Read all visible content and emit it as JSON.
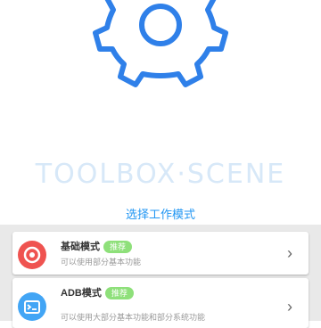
{
  "brand": "TOOLBOX·SCENE",
  "mode_title": "选择工作模式",
  "modes": [
    {
      "title": "基础模式",
      "badge": "推荐",
      "description": "可以使用部分基本功能",
      "icon": "circle-dot-icon",
      "color": "#ef5350"
    },
    {
      "title": "ADB模式",
      "badge": "推荐",
      "description": "可以使用大部分基本功能和部分系统功能",
      "icon": "terminal-icon",
      "color": "#42a5f5"
    }
  ],
  "colors": {
    "accent": "#2196f3",
    "badge": "#8ee07a"
  }
}
